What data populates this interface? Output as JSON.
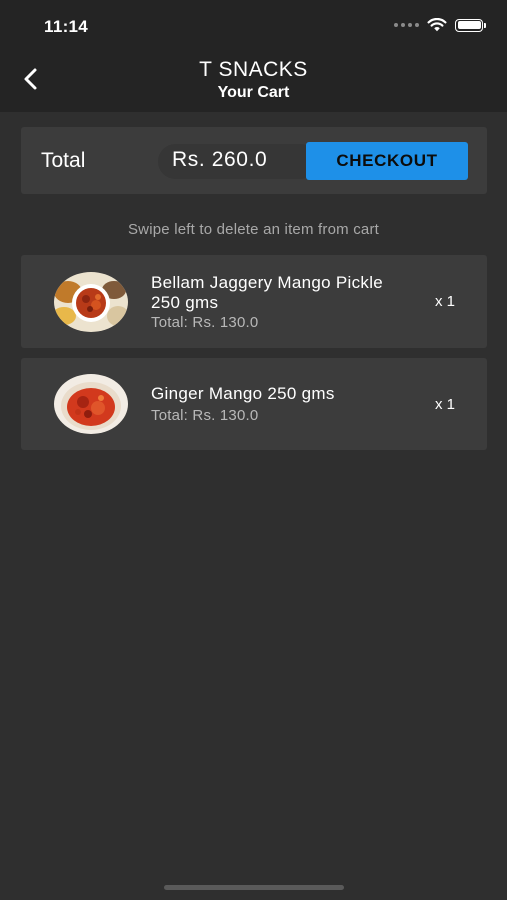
{
  "status_bar": {
    "time": "11:14",
    "icons": [
      "signal-dots-icon",
      "wifi-icon",
      "battery-icon"
    ]
  },
  "header": {
    "back_icon": "chevron-left-icon",
    "title": "T SNACKS",
    "subtitle": "Your Cart"
  },
  "summary": {
    "total_label": "Total",
    "total_amount": "Rs. 260.0",
    "checkout_label": "CHECKOUT"
  },
  "hint": "Swipe left to delete an item from cart",
  "items": [
    {
      "name": "Bellam Jaggery Mango Pickle 250 gms",
      "total": "Total: Rs. 130.0",
      "qty": "x 1"
    },
    {
      "name": "Ginger Mango 250 gms",
      "total": "Total: Rs. 130.0",
      "qty": "x 1"
    }
  ],
  "colors": {
    "background": "#2f2f2f",
    "bar": "#242424",
    "card": "#3c3c3c",
    "accent": "#1e90e8",
    "muted_text": "#a8a8a8"
  }
}
